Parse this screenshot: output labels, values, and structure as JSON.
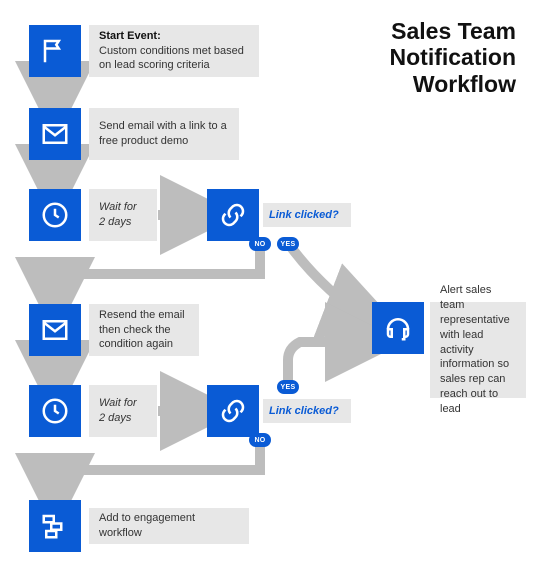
{
  "title_l1": "Sales Team",
  "title_l2": "Notification",
  "title_l3": "Workflow",
  "colors": {
    "brand": "#0a5bd5",
    "box": "#e7e7e7",
    "arrow": "#bdbdbd"
  },
  "steps": {
    "start": {
      "icon": "flag-icon",
      "heading": "Start Event:",
      "text": "Custom conditions met based on lead scoring criteria"
    },
    "send_email": {
      "icon": "mail-icon",
      "text": "Send email with a link to a free product demo"
    },
    "wait1": {
      "icon": "clock-icon",
      "text_l1": "Wait for",
      "text_l2": "2 days"
    },
    "link1": {
      "icon": "link-icon",
      "question": "Link clicked?"
    },
    "resend": {
      "icon": "mail-icon",
      "text": "Resend the email then check the condition again"
    },
    "wait2": {
      "icon": "clock-icon",
      "text_l1": "Wait for",
      "text_l2": "2 days"
    },
    "link2": {
      "icon": "link-icon",
      "question": "Link clicked?"
    },
    "alert": {
      "icon": "headset-icon",
      "text": "Alert sales team representative with lead activity information so sales rep can reach out to lead"
    },
    "engage": {
      "icon": "workflow-icon",
      "text": "Add to engagement workflow"
    }
  },
  "branches": {
    "no": "NO",
    "yes": "YES"
  }
}
